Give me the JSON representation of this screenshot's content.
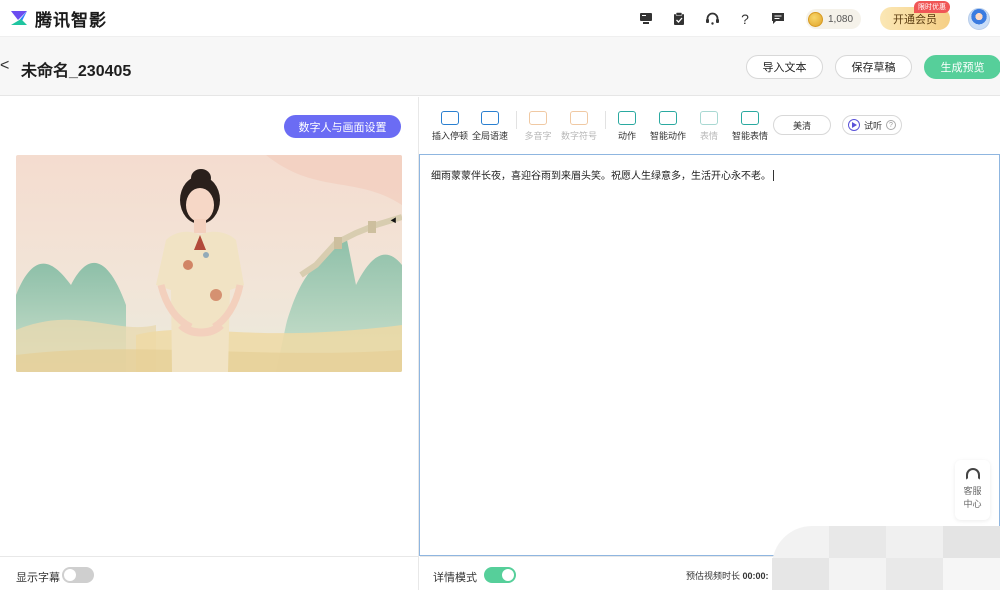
{
  "app": {
    "name": "腾讯智影",
    "brand_colors": {
      "logo_purple": "#6b4df0",
      "logo_blue": "#2b7fff",
      "logo_green": "#1fc5a0"
    }
  },
  "nav": {
    "icons": [
      "monitor-icon",
      "clipboard-icon",
      "headset-icon",
      "help-icon",
      "message-icon"
    ],
    "help_glyph": "?",
    "coins": "1,080",
    "vip_label": "开通会员",
    "vip_badge": "限时优惠"
  },
  "header": {
    "back_glyph": "<",
    "title": "未命名_230405",
    "import_label": "导入文本",
    "save_label": "保存草稿",
    "generate_label": "生成预览"
  },
  "left": {
    "settings_label": "数字人与画面设置",
    "subtitle_label": "显示字幕",
    "subtitle_on": false
  },
  "toolbar": {
    "tools": [
      {
        "label": "插入停顿",
        "enabled": true
      },
      {
        "label": "全局语速",
        "enabled": true
      },
      {
        "label": "多音字",
        "enabled": false
      },
      {
        "label": "数字符号",
        "enabled": false
      },
      {
        "label": "动作",
        "enabled": true
      },
      {
        "label": "智能动作",
        "enabled": true
      },
      {
        "label": "表情",
        "enabled": false
      },
      {
        "label": "智能表情",
        "enabled": true
      }
    ],
    "voice_label": "美清",
    "listen_label": "试听",
    "help_glyph": "?"
  },
  "editor": {
    "text": "细雨蒙蒙伴长夜，喜迎谷雨到来眉头笑。祝愿人生绿意多，生活开心永不老。"
  },
  "service": {
    "line1": "客服",
    "line2": "中心"
  },
  "footer": {
    "detail_mode_label": "详情模式",
    "detail_mode_on": true,
    "duration_label": "预估视频时长",
    "duration_value": "00:00:"
  },
  "colors": {
    "accent_green": "#56cf9a",
    "accent_purple": "#6b6cf4",
    "editor_border": "#8fb6e0"
  }
}
